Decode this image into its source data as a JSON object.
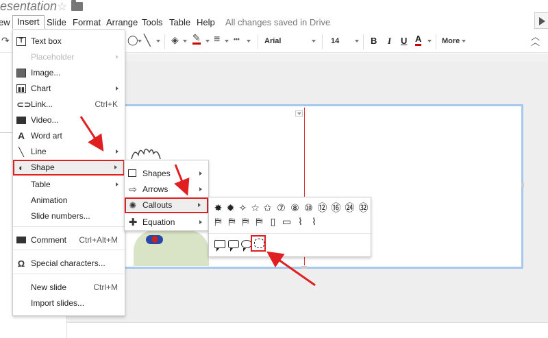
{
  "doc": {
    "title": "esentation"
  },
  "menubar": {
    "items": [
      "ew",
      "Insert",
      "Slide",
      "Format",
      "Arrange",
      "Tools",
      "Table",
      "Help"
    ],
    "saved_status": "All changes saved in Drive"
  },
  "toolbar": {
    "font": "Arial",
    "font_size": "14",
    "bold": "B",
    "italic": "I",
    "underline": "U",
    "text_color": "A",
    "more": "More"
  },
  "insert_menu": {
    "items": [
      {
        "label": "Text box",
        "shortcut": "",
        "submenu": false,
        "icon": "text-box-icon"
      },
      {
        "label": "Placeholder",
        "shortcut": "",
        "submenu": true,
        "disabled": true
      },
      {
        "label": "Image...",
        "shortcut": "",
        "submenu": false,
        "icon": "image-icon"
      },
      {
        "label": "Chart",
        "shortcut": "",
        "submenu": true,
        "icon": "chart-icon"
      },
      {
        "label": "Link...",
        "shortcut": "Ctrl+K",
        "submenu": false,
        "icon": "link-icon"
      },
      {
        "label": "Video...",
        "shortcut": "",
        "submenu": false,
        "icon": "video-icon"
      },
      {
        "label": "Word art",
        "shortcut": "",
        "submenu": false,
        "icon": "word-art-icon"
      },
      {
        "label": "Line",
        "shortcut": "",
        "submenu": true,
        "icon": "line-icon"
      },
      {
        "label": "Shape",
        "shortcut": "",
        "submenu": true,
        "icon": "shape-icon",
        "highlight": true
      },
      {
        "label": "Table",
        "shortcut": "",
        "submenu": true
      },
      {
        "label": "Animation",
        "shortcut": "",
        "submenu": false
      },
      {
        "label": "Slide numbers...",
        "shortcut": "",
        "submenu": false
      },
      {
        "label": "Comment",
        "shortcut": "Ctrl+Alt+M",
        "submenu": false,
        "icon": "comment-icon"
      },
      {
        "label": "Special characters...",
        "shortcut": "",
        "submenu": false,
        "icon": "omega-icon"
      },
      {
        "label": "New slide",
        "shortcut": "Ctrl+M",
        "submenu": false
      },
      {
        "label": "Import slides...",
        "shortcut": "",
        "submenu": false
      }
    ]
  },
  "shape_menu": {
    "items": [
      {
        "label": "Shapes"
      },
      {
        "label": "Arrows"
      },
      {
        "label": "Callouts",
        "highlight": true
      },
      {
        "label": "Equation"
      }
    ]
  },
  "callouts_menu": {
    "row1": [
      "✸",
      "✹",
      "✧",
      "☆",
      "✩",
      "⑦",
      "⑧",
      "⑩",
      "⑫",
      "⑯",
      "㉔",
      "㉜"
    ],
    "row2": [
      "⌑",
      "⌑",
      "⌑",
      "⌑",
      "⌑",
      "⌑",
      "⌑",
      "⌑"
    ],
    "accent": "#e02020"
  },
  "colors": {
    "highlight_border": "#e02020",
    "slide_border": "#a7c7ee"
  }
}
